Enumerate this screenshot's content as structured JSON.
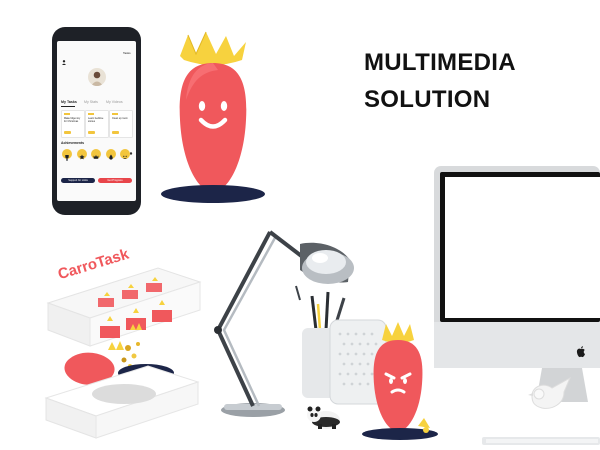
{
  "headline": {
    "line1": "MULTIMEDIA",
    "line2": "SOLUTION"
  },
  "phone": {
    "top_right": "Tasks",
    "tabs": [
      "My Tasks",
      "My Stats",
      "My Videos"
    ],
    "tasks": [
      {
        "title": "Make fidget toy for Christmas"
      },
      {
        "title": "Learn bedtime stories"
      },
      {
        "title": "Clean up room"
      }
    ],
    "achievements_label": "Achievements",
    "achievement_icons": [
      "trophy-icon",
      "star-icon",
      "crown-icon",
      "drop-icon",
      "face-icon"
    ],
    "buttons": {
      "left": "Support for Links",
      "right": "Get Progress"
    }
  },
  "box": {
    "brand": "CarroTask"
  },
  "colors": {
    "carrot": "#f0585c",
    "crown": "#f7d23e",
    "base": "#1c2548",
    "phone_button_dark": "#1c2548",
    "phone_button_red": "#e8454a"
  }
}
